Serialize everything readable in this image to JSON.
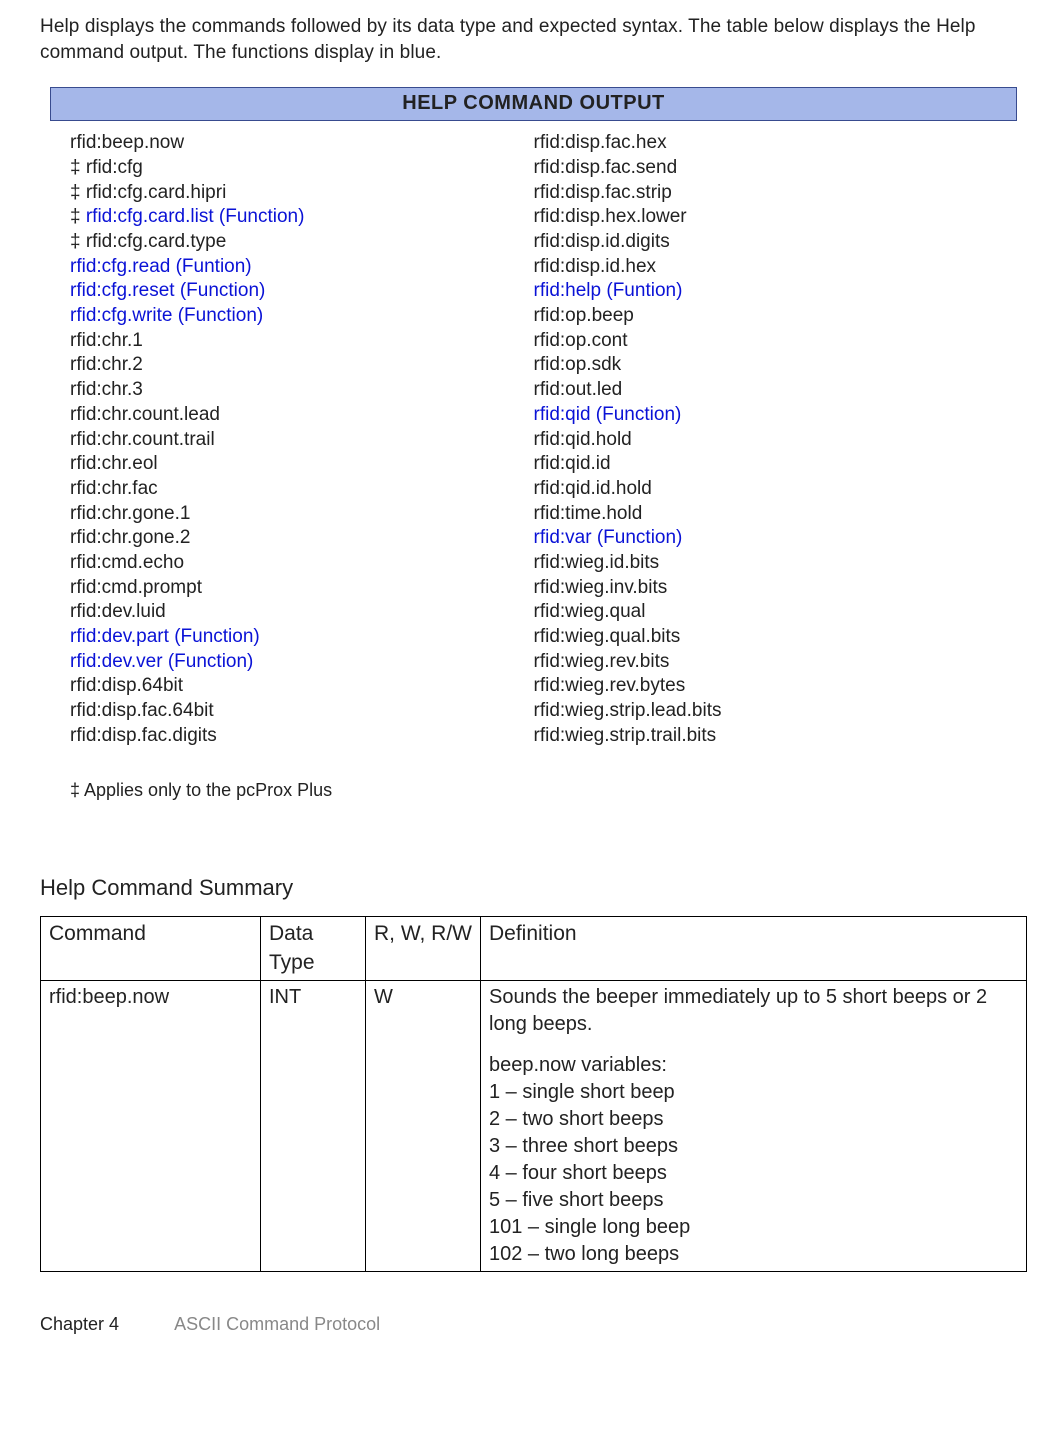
{
  "intro": "Help displays the commands followed by its data type and expected syntax. The table below displays the Help command output. The functions display in blue.",
  "help_header": "HELP COMMAND OUTPUT",
  "columns": {
    "left": [
      {
        "prefix": "",
        "text": "rfid:beep.now",
        "fn": false
      },
      {
        "prefix": "‡  ",
        "text": "rfid:cfg",
        "fn": false
      },
      {
        "prefix": "‡ ",
        "text": "rfid:cfg.card.hipri",
        "fn": false
      },
      {
        "prefix": "‡ ",
        "text": "rfid:cfg.card.list  (Function)",
        "fn": true
      },
      {
        "prefix": "‡ ",
        "text": "rfid:cfg.card.type",
        "fn": false
      },
      {
        "prefix": "",
        "text": "rfid:cfg.read (Funtion)",
        "fn": true
      },
      {
        "prefix": "",
        "text": "rfid:cfg.reset (Function)",
        "fn": true
      },
      {
        "prefix": "",
        "text": "rfid:cfg.write (Function)",
        "fn": true
      },
      {
        "prefix": "",
        "text": "rfid:chr.1",
        "fn": false
      },
      {
        "prefix": "",
        "text": "rfid:chr.2",
        "fn": false
      },
      {
        "prefix": "",
        "text": "rfid:chr.3",
        "fn": false
      },
      {
        "prefix": "",
        "text": "rfid:chr.count.lead",
        "fn": false
      },
      {
        "prefix": "",
        "text": "rfid:chr.count.trail",
        "fn": false
      },
      {
        "prefix": "",
        "text": "rfid:chr.eol",
        "fn": false
      },
      {
        "prefix": "",
        "text": "rfid:chr.fac",
        "fn": false
      },
      {
        "prefix": "",
        "text": "rfid:chr.gone.1",
        "fn": false
      },
      {
        "prefix": "",
        "text": "rfid:chr.gone.2",
        "fn": false
      },
      {
        "prefix": "",
        "text": "rfid:cmd.echo",
        "fn": false
      },
      {
        "prefix": "",
        "text": "rfid:cmd.prompt",
        "fn": false
      },
      {
        "prefix": "",
        "text": "rfid:dev.luid",
        "fn": false
      },
      {
        "prefix": "",
        "text": "rfid:dev.part (Function)",
        "fn": true
      },
      {
        "prefix": "",
        "text": "rfid:dev.ver (Function)",
        "fn": true
      },
      {
        "prefix": "",
        "text": "rfid:disp.64bit",
        "fn": false
      },
      {
        "prefix": "",
        "text": "rfid:disp.fac.64bit",
        "fn": false
      },
      {
        "prefix": "",
        "text": "rfid:disp.fac.digits",
        "fn": false
      }
    ],
    "right": [
      {
        "prefix": "",
        "text": "rfid:disp.fac.hex",
        "fn": false
      },
      {
        "prefix": "",
        "text": "rfid:disp.fac.send",
        "fn": false
      },
      {
        "prefix": "",
        "text": "rfid:disp.fac.strip",
        "fn": false
      },
      {
        "prefix": "",
        "text": "rfid:disp.hex.lower",
        "fn": false
      },
      {
        "prefix": "",
        "text": "rfid:disp.id.digits",
        "fn": false
      },
      {
        "prefix": "",
        "text": "rfid:disp.id.hex",
        "fn": false
      },
      {
        "prefix": "",
        "text": "rfid:help (Funtion)",
        "fn": true
      },
      {
        "prefix": "",
        "text": "rfid:op.beep",
        "fn": false
      },
      {
        "prefix": "",
        "text": "rfid:op.cont",
        "fn": false
      },
      {
        "prefix": "",
        "text": "rfid:op.sdk",
        "fn": false
      },
      {
        "prefix": "",
        "text": "rfid:out.led",
        "fn": false
      },
      {
        "prefix": "",
        "text": "rfid:qid (Function)",
        "fn": true
      },
      {
        "prefix": "",
        "text": "rfid:qid.hold",
        "fn": false
      },
      {
        "prefix": "",
        "text": "rfid:qid.id",
        "fn": false
      },
      {
        "prefix": "",
        "text": "rfid:qid.id.hold",
        "fn": false
      },
      {
        "prefix": "",
        "text": "rfid:time.hold",
        "fn": false
      },
      {
        "prefix": "",
        "text": "rfid:var (Function)",
        "fn": true
      },
      {
        "prefix": "",
        "text": "rfid:wieg.id.bits",
        "fn": false
      },
      {
        "prefix": "",
        "text": "rfid:wieg.inv.bits",
        "fn": false
      },
      {
        "prefix": "",
        "text": "rfid:wieg.qual",
        "fn": false
      },
      {
        "prefix": "",
        "text": "rfid:wieg.qual.bits",
        "fn": false
      },
      {
        "prefix": "",
        "text": "rfid:wieg.rev.bits",
        "fn": false
      },
      {
        "prefix": "",
        "text": "rfid:wieg.rev.bytes",
        "fn": false
      },
      {
        "prefix": "",
        "text": "rfid:wieg.strip.lead.bits",
        "fn": false
      },
      {
        "prefix": "",
        "text": "rfid:wieg.strip.trail.bits",
        "fn": false
      }
    ]
  },
  "note": "‡ Applies only to the pcProx Plus",
  "summary_title": "Help Command Summary",
  "table": {
    "headers": [
      "Command",
      "Data Type",
      "R, W, R/W",
      "Definition"
    ],
    "row": {
      "command": "rfid:beep.now",
      "datatype": "INT",
      "rw": "W",
      "def_intro": "Sounds the beeper immediately  up to 5 short beeps or 2 long beeps.",
      "var_head": "beep.now variables:",
      "vars": [
        "1 – single short beep",
        "2 – two short beeps",
        "3 – three short beeps",
        "4  – four short beeps",
        "5 – five short beeps",
        "101 – single long beep",
        "102  – two long beeps"
      ]
    }
  },
  "footer": {
    "chapter": "Chapter 4",
    "title": "ASCII Command Protocol"
  }
}
